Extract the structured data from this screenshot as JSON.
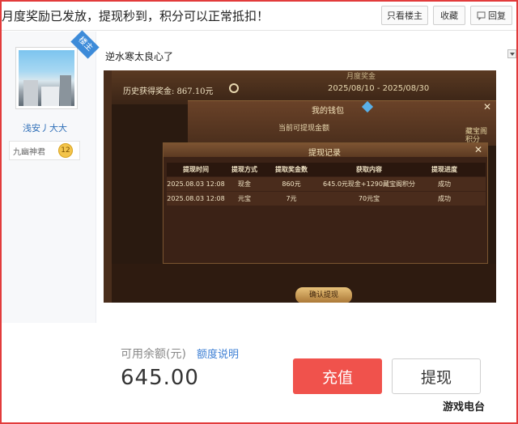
{
  "topbar": {
    "title": "月度奖励已发放，提现秒到，积分可以正常抵扣！",
    "only_owner": "只看楼主",
    "favorite": "收藏",
    "reply": "回复",
    "reply_icon": "comment-icon"
  },
  "user": {
    "owner_tag": "楼主",
    "name": "浅安丿大大",
    "rank_name": "九幽神君",
    "rank_level": "12"
  },
  "post": {
    "text": "逆水寒太良心了"
  },
  "game": {
    "history_label": "历史获得奖金: 867.10元",
    "date_range": "2025/08/10 - 2025/08/30",
    "header_faint": "月度奖金",
    "wallet_title": "我的钱包",
    "wallet_sub": "当前可提现金额",
    "side_label": "藏宝阁积分",
    "record_title": "提现记录",
    "columns": [
      "提现时间",
      "提现方式",
      "提取奖金数",
      "获取内容",
      "提现进度"
    ],
    "rows": [
      [
        "2025.08.03  12:08",
        "现金",
        "860元",
        "645.0元现金+1290藏宝阁积分",
        "成功"
      ],
      [
        "2025.08.03  12:08",
        "元宝",
        "7元",
        "70元宝",
        "成功"
      ]
    ],
    "confirm": "确认提现",
    "close": "✕"
  },
  "wallet_panel": {
    "balance_label": "可用余额(元)",
    "quota_link": "额度说明",
    "balance": "645.00",
    "recharge": "充值",
    "withdraw": "提现"
  },
  "watermark": "游戏电台"
}
